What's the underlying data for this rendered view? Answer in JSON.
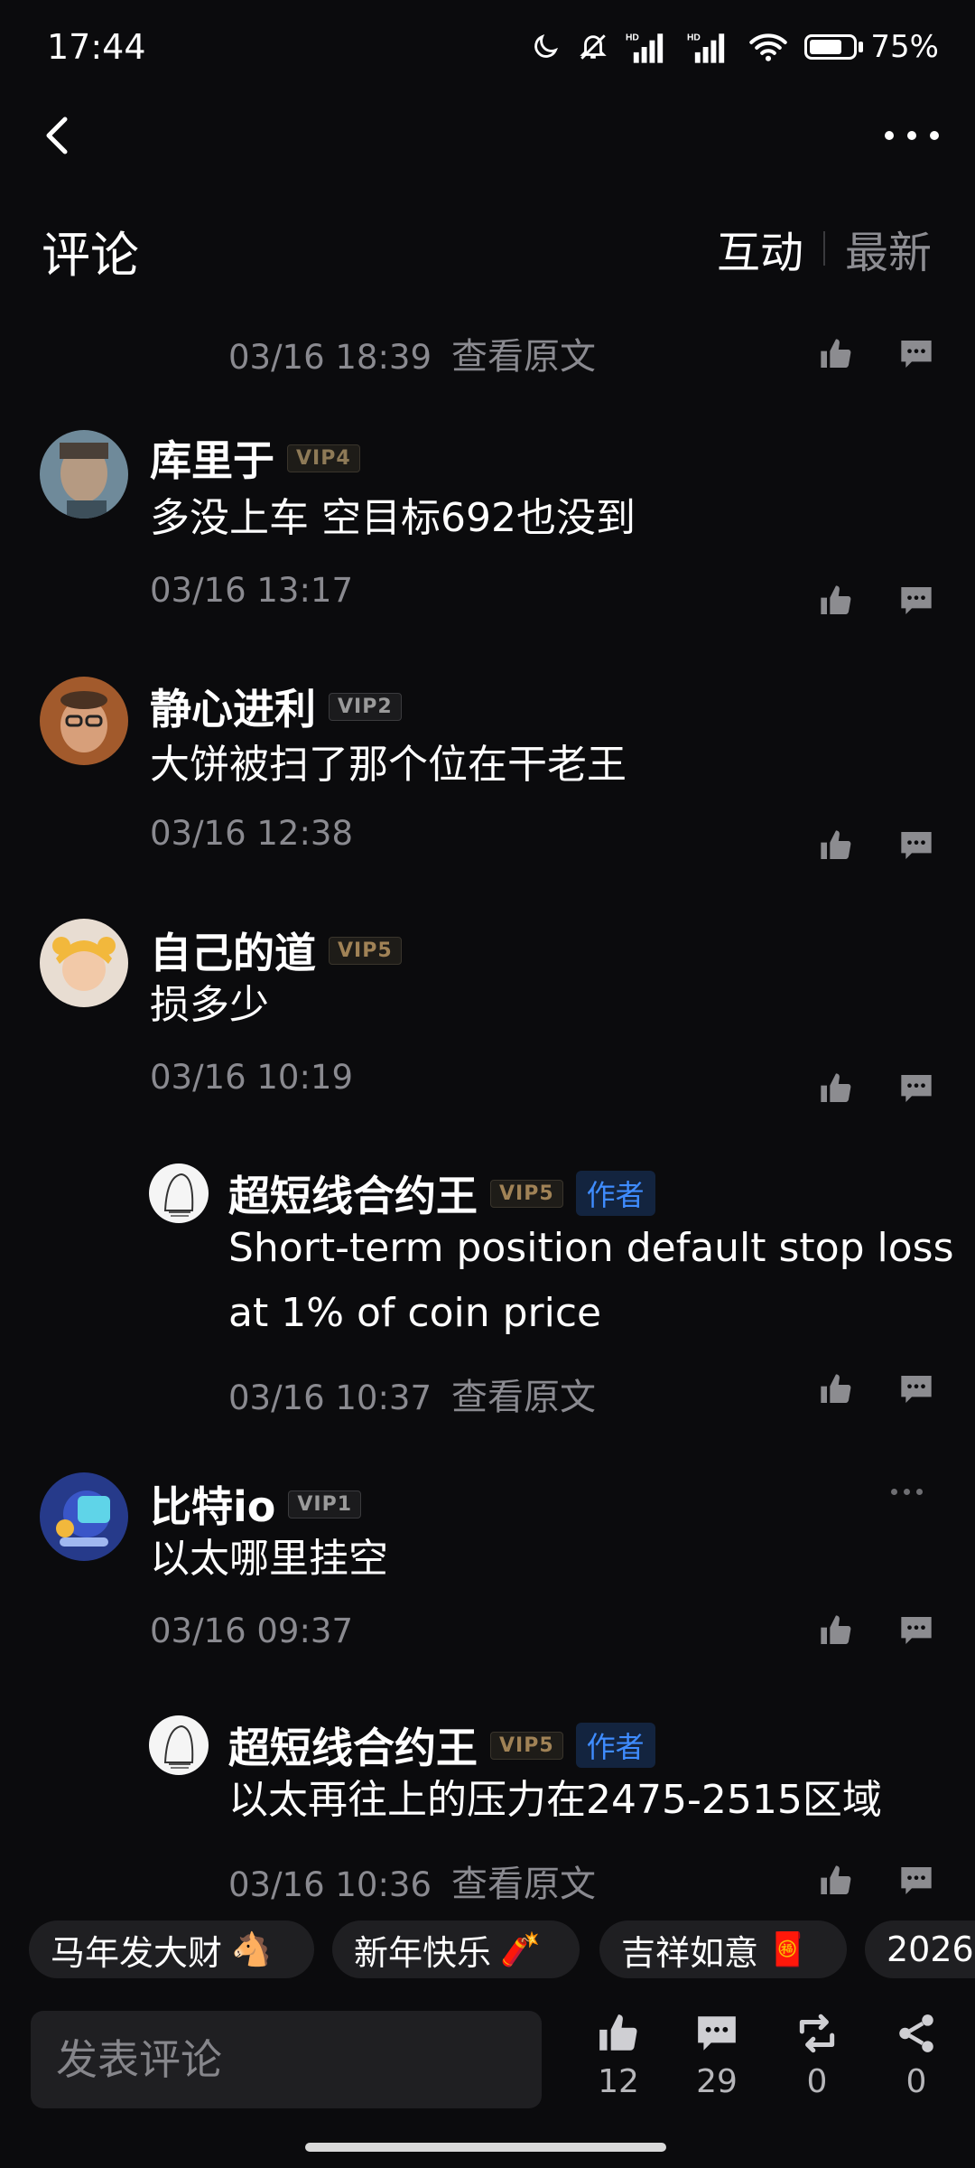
{
  "status_bar": {
    "time": "17:44",
    "battery": "75%",
    "battery_level": 0.75
  },
  "header": {
    "title": "评论",
    "tabs": [
      "互动",
      "最新"
    ]
  },
  "comments": [
    {
      "user": "",
      "vip": "",
      "text": "",
      "time": "03/16 18:39",
      "view_original": "查看原文"
    },
    {
      "user": "库里于",
      "vip": "VIP4",
      "text": "多没上车 空目标692也没到",
      "time": "03/16 13:17"
    },
    {
      "user": "静心进利",
      "vip": "VIP2",
      "text": "大饼被扫了那个位在干老王",
      "time": "03/16 12:38"
    },
    {
      "user": "自己的道",
      "vip": "VIP5",
      "text": "损多少",
      "time": "03/16 10:19"
    },
    {
      "user": "超短线合约王",
      "vip": "VIP5",
      "author_badge": "作者",
      "text_line1": "Short-term position default stop loss",
      "text_line2": "at 1% of coin price",
      "time": "03/16 10:37",
      "view_original": "查看原文"
    },
    {
      "user": "比特io",
      "vip": "VIP1",
      "text": "以太哪里挂空",
      "time": "03/16 09:37"
    },
    {
      "user": "超短线合约王",
      "vip": "VIP5",
      "author_badge": "作者",
      "text": "以太再往上的压力在2475-2515区域",
      "time": "03/16 10:36",
      "view_original": "查看原文"
    }
  ],
  "quick_phrases": [
    {
      "text": "马年发大财",
      "emoji": "🐴"
    },
    {
      "text": "新年快乐",
      "emoji": "🧨"
    },
    {
      "text": "吉祥如意",
      "emoji": "🧧"
    },
    {
      "text": "2026",
      "emoji": ""
    }
  ],
  "bottom_bar": {
    "placeholder": "发表评论",
    "likes": "12",
    "comments": "29",
    "reposts": "0",
    "shares": "0"
  }
}
